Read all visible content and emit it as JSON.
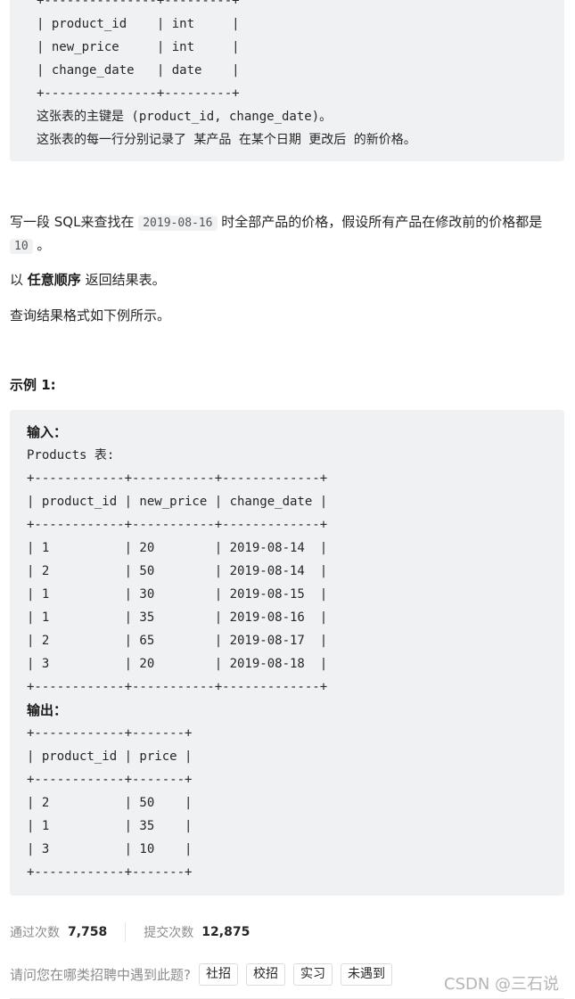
{
  "schema_block": {
    "lines": [
      "+---------------+---------+",
      "| product_id    | int     |",
      "| new_price     | int     |",
      "| change_date   | date    |",
      "+---------------+---------+"
    ],
    "primary_key_note": "这张表的主键是 (product_id, change_date)。",
    "row_note": "这张表的每一行分别记录了 某产品 在某个日期 更改后 的新价格。"
  },
  "description": {
    "p1_before": "写一段 SQL来查找在 ",
    "p1_code": "2019-08-16",
    "p1_after": " 时全部产品的价格，假设所有产品在修改前的价格都是 ",
    "p1_code2": "10",
    "p1_end": " 。",
    "p2_before": "以 ",
    "p2_bold": "任意顺序",
    "p2_after": " 返回结果表。",
    "p3": "查询结果格式如下例所示。"
  },
  "example": {
    "title": "示例 1:",
    "input_label": "输入：",
    "table_caption": "Products 表:",
    "input_table": {
      "border": "+------------+-----------+-------------+",
      "header": "| product_id | new_price | change_date |",
      "columns": [
        "product_id",
        "new_price",
        "change_date"
      ],
      "rows": [
        [
          "1",
          "20",
          "2019-08-14"
        ],
        [
          "2",
          "50",
          "2019-08-14"
        ],
        [
          "1",
          "30",
          "2019-08-15"
        ],
        [
          "1",
          "35",
          "2019-08-16"
        ],
        [
          "2",
          "65",
          "2019-08-17"
        ],
        [
          "3",
          "20",
          "2019-08-18"
        ]
      ],
      "row_lines": [
        "| 1          | 20        | 2019-08-14  |",
        "| 2          | 50        | 2019-08-14  |",
        "| 1          | 30        | 2019-08-15  |",
        "| 1          | 35        | 2019-08-16  |",
        "| 2          | 65        | 2019-08-17  |",
        "| 3          | 20        | 2019-08-18  |"
      ]
    },
    "output_label": "输出：",
    "output_table": {
      "border": "+------------+-------+",
      "header": "| product_id | price |",
      "columns": [
        "product_id",
        "price"
      ],
      "rows": [
        [
          "2",
          "50"
        ],
        [
          "1",
          "35"
        ],
        [
          "3",
          "10"
        ]
      ],
      "row_lines": [
        "| 2          | 50    |",
        "| 1          | 35    |",
        "| 3          | 10    |"
      ]
    }
  },
  "stats": {
    "accepted_label": "通过次数",
    "accepted_value": "7,758",
    "submitted_label": "提交次数",
    "submitted_value": "12,875"
  },
  "recruit": {
    "question": "请问您在哪类招聘中遇到此题?",
    "tags": [
      "社招",
      "校招",
      "实习",
      "未遇到"
    ]
  },
  "watermark": "CSDN @三石说"
}
